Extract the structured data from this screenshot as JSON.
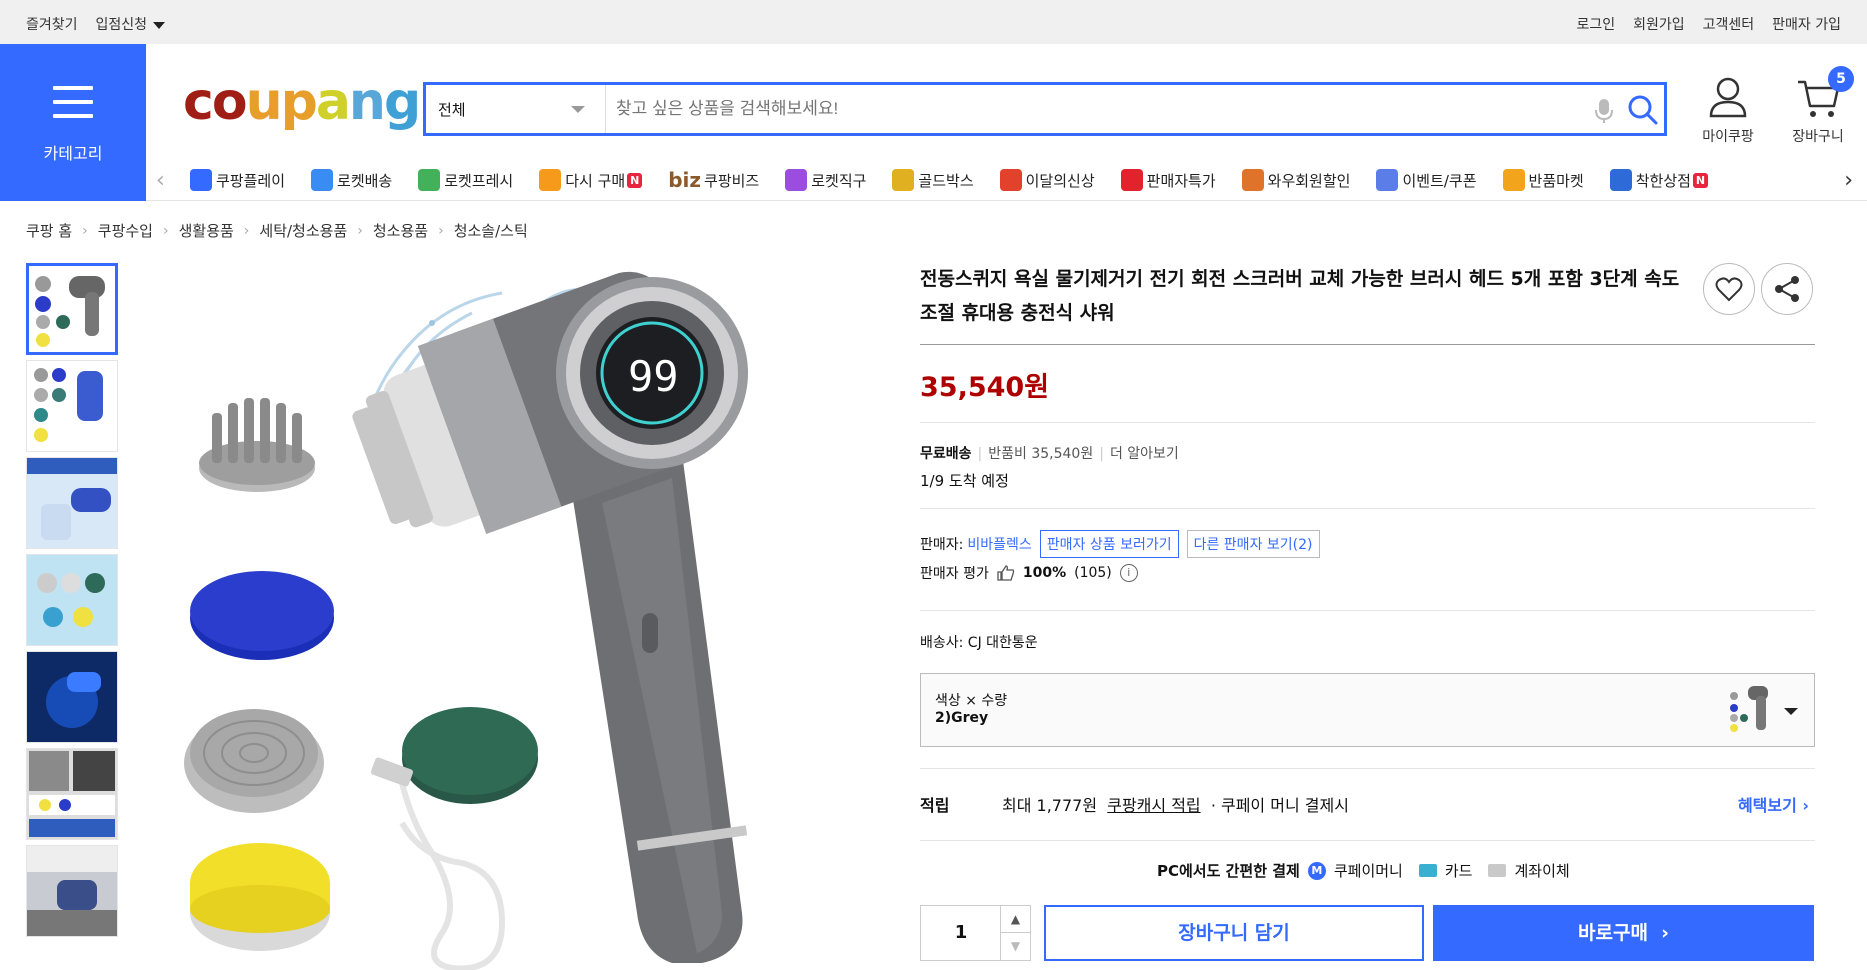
{
  "topbar": {
    "favorites": "즐겨찾기",
    "seller_apply": "입점신청",
    "login": "로그인",
    "signup": "회원가입",
    "customer_center": "고객센터",
    "seller_join": "판매자 가입"
  },
  "header": {
    "category_label": "카테고리",
    "logo": "coupang",
    "search_scope": "전체",
    "search_placeholder": "찾고 싶은 상품을 검색해보세요!",
    "my_coupang": "마이쿠팡",
    "cart": "장바구니",
    "cart_count": "5"
  },
  "nav": {
    "items": [
      {
        "label": "쿠팡플레이",
        "icon": "play-icon",
        "color": "#346aff"
      },
      {
        "label": "로켓배송",
        "icon": "rocket-icon",
        "color": "#3a8cf5"
      },
      {
        "label": "로켓프레시",
        "icon": "rocket-fresh-icon",
        "color": "#43b15a"
      },
      {
        "label": "다시 구매",
        "icon": "repurchase-icon",
        "color": "#f59a1b",
        "badge": "N"
      },
      {
        "label": "쿠팡비즈",
        "icon": "biz-icon",
        "color": "#8b5a2b",
        "prefix": "biz"
      },
      {
        "label": "로켓직구",
        "icon": "global-rocket-icon",
        "color": "#9b4de0"
      },
      {
        "label": "골드박스",
        "icon": "goldbox-icon",
        "color": "#e0b020"
      },
      {
        "label": "이달의신상",
        "icon": "new-icon",
        "color": "#e2412c"
      },
      {
        "label": "판매자특가",
        "icon": "percent-icon",
        "color": "#e2232e"
      },
      {
        "label": "와우회원할인",
        "icon": "wow-icon",
        "color": "#e0732a"
      },
      {
        "label": "이벤트/쿠폰",
        "icon": "coupon-icon",
        "color": "#5b7de8"
      },
      {
        "label": "반품마켓",
        "icon": "return-market-icon",
        "color": "#f2a41d"
      },
      {
        "label": "착한상점",
        "icon": "good-store-icon",
        "color": "#2f6ad9",
        "badge": "N"
      }
    ]
  },
  "breadcrumb": [
    "쿠팡 홈",
    "쿠팡수입",
    "생활용품",
    "세탁/청소용품",
    "청소용품",
    "청소솔/스틱"
  ],
  "product": {
    "title": "전동스퀴지 욕실 물기제거기 전기 회전 스크러버 교체 가능한 브러시 헤드 5개 포함 3단계 속도 조절 휴대용 충전식 샤워",
    "price": "35,540원",
    "free_shipping": "무료배송",
    "return_fee": "반품비 35,540원",
    "more": "더 알아보기",
    "arrival": "1/9 도착 예정",
    "seller_label": "판매자:",
    "seller_name": "비바플렉스",
    "seller_products_btn": "판매자 상품 보러가기",
    "other_sellers_btn": "다른 판매자 보기(2)",
    "seller_rating_label": "판매자 평가",
    "seller_rating": "100%",
    "seller_rating_count": "(105)",
    "carrier": "배송사:  CJ 대한통운",
    "option_label": "색상 × 수량",
    "option_value": "2)Grey",
    "points_label": "적립",
    "points_text": "최대 1,777원",
    "points_link": "쿠팡캐시 적립",
    "points_tail": "· 쿠페이 머니 결제시",
    "benefits": "혜택보기",
    "pay_label": "PC에서도 간편한 결제",
    "pay_money": "쿠페이머니",
    "pay_card": "카드",
    "pay_bank": "계좌이체",
    "quantity": "1",
    "add_cart": "장바구니 담기",
    "buy_now": "바로구매",
    "display_number": "99"
  },
  "colors": {
    "accent": "#346aff",
    "price": "#ae0000"
  }
}
